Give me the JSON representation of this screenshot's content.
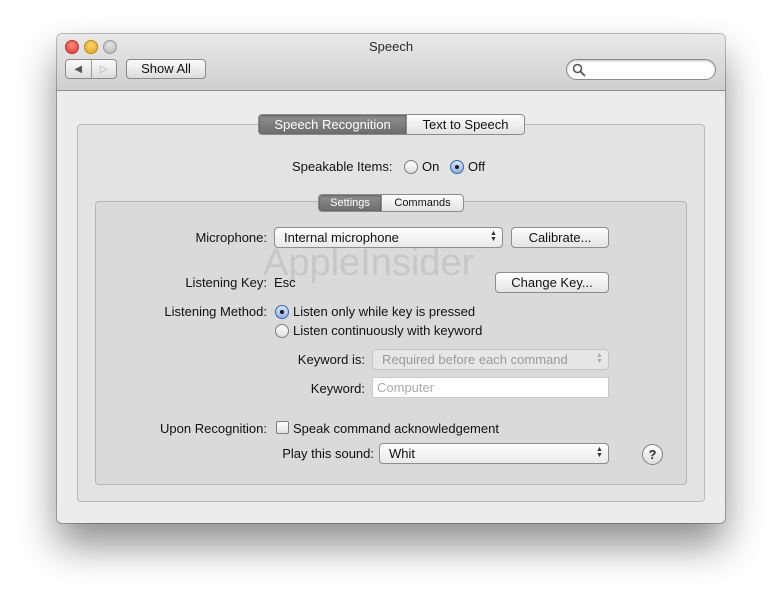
{
  "window": {
    "title": "Speech"
  },
  "toolbar": {
    "back_glyph": "◀",
    "forward_glyph": "▷",
    "show_all_label": "Show All",
    "search_placeholder": ""
  },
  "tabs": [
    {
      "label": "Speech Recognition",
      "selected": true
    },
    {
      "label": "Text to Speech",
      "selected": false
    }
  ],
  "speakable_items": {
    "label": "Speakable Items:",
    "on_label": "On",
    "off_label": "Off",
    "selected": "Off"
  },
  "subtabs": [
    {
      "label": "Settings",
      "selected": true
    },
    {
      "label": "Commands",
      "selected": false
    }
  ],
  "settings": {
    "microphone": {
      "label": "Microphone:",
      "value": "Internal microphone",
      "calibrate_label": "Calibrate..."
    },
    "listening_key": {
      "label": "Listening Key:",
      "value": "Esc",
      "change_label": "Change Key..."
    },
    "listening_method": {
      "label": "Listening Method:",
      "option1": "Listen only while key is pressed",
      "option2": "Listen continuously with keyword",
      "selected": "option1"
    },
    "keyword_is": {
      "label": "Keyword is:",
      "value": "Required before each command"
    },
    "keyword": {
      "label": "Keyword:",
      "placeholder": "Computer"
    },
    "upon_recognition": {
      "label": "Upon Recognition:",
      "checkbox_label": "Speak command acknowledgement",
      "checked": false
    },
    "play_sound": {
      "label": "Play this sound:",
      "value": "Whit"
    }
  },
  "help": {
    "glyph": "?"
  },
  "watermark": {
    "text": "AppleInsider"
  },
  "colors": {
    "selected_tab": "#7d7d7d",
    "window_bg": "#ececec",
    "radio_selected": "#8fb2e6"
  }
}
